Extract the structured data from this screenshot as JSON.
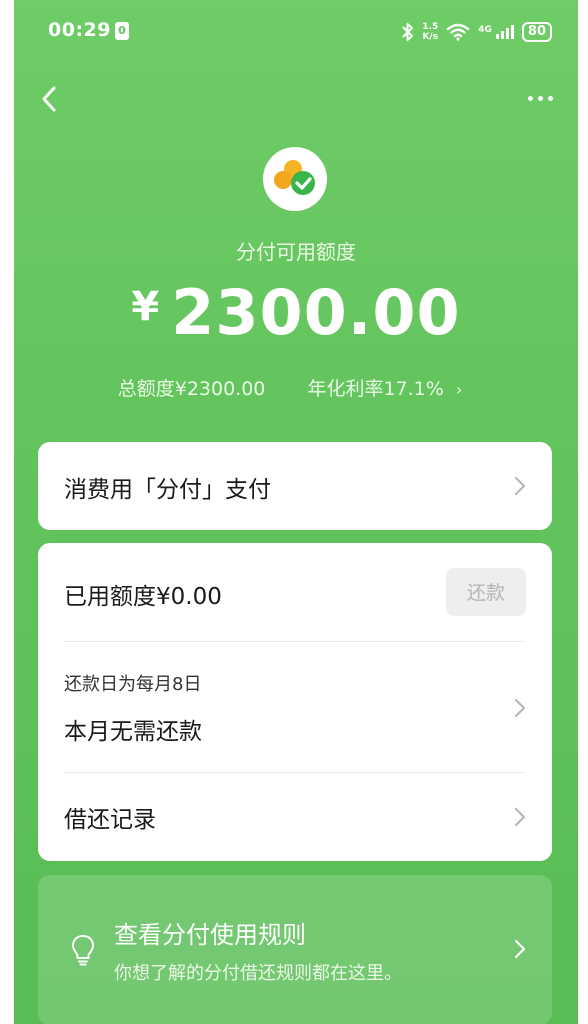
{
  "status_bar": {
    "time": "00:29",
    "sim_badge": "0",
    "net_speed_value": "1.5",
    "net_speed_unit": "K/s",
    "network_type": "4G",
    "battery": "80",
    "icons": [
      "bluetooth-icon",
      "wifi-icon",
      "signal-icon",
      "battery-icon"
    ]
  },
  "nav": {
    "back_icon": "chevron-left-icon",
    "more_icon": "more-dots-icon"
  },
  "header": {
    "logo_icon": "fenfu-logo-icon",
    "label": "分付可用额度",
    "currency": "¥",
    "amount": "2300.00",
    "total_limit": "总额度¥2300.00",
    "annual_rate": "年化利率17.1%"
  },
  "pay_card": {
    "title": "消费用「分付」支付"
  },
  "usage_card": {
    "used": "已用额度¥0.00",
    "repay_button": "还款",
    "repay_day": "还款日为每月8日",
    "repay_status": "本月无需还款",
    "records": "借还记录"
  },
  "rules_card": {
    "title": "查看分付使用规则",
    "desc": "你想了解的分付借还规则都在这里。"
  },
  "colors": {
    "background_green": "#63c45d",
    "card_white": "#ffffff",
    "disabled_button": "#eeeeee"
  }
}
